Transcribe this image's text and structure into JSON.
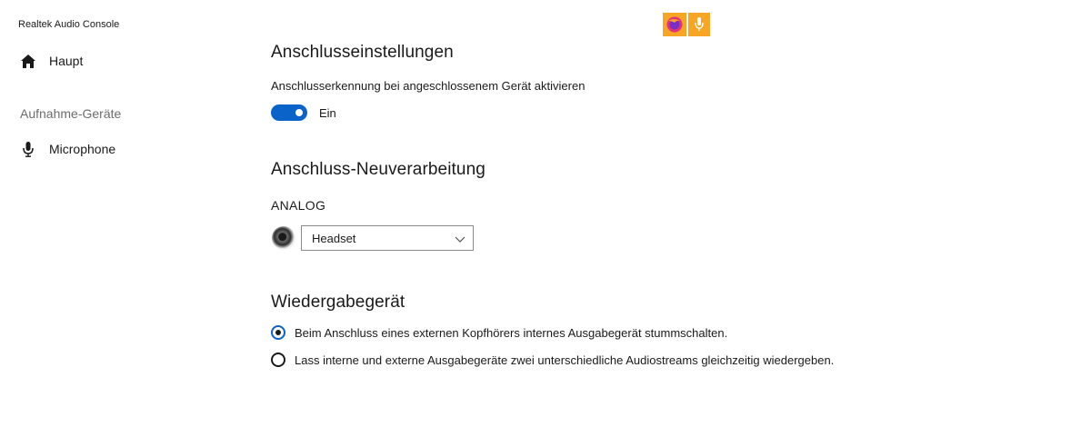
{
  "app": {
    "title": "Realtek Audio Console"
  },
  "sidebar": {
    "items": [
      {
        "label": "Haupt",
        "icon": "home-icon"
      },
      {
        "label": "Microphone",
        "icon": "microphone-icon"
      }
    ],
    "section_label": "Aufnahme-Geräte"
  },
  "tray": {
    "icons": [
      "firefox-icon",
      "microphone-icon"
    ],
    "accent": "#f6a524"
  },
  "main": {
    "connection_settings": {
      "title": "Anschlusseinstellungen",
      "description": "Anschlusserkennung bei angeschlossenem Gerät aktivieren",
      "toggle_label": "Ein",
      "toggle_on": true,
      "toggle_color": "#0a63c9"
    },
    "reassignment": {
      "title": "Anschluss-Neuverarbeitung",
      "group_label": "ANALOG",
      "device_selected": "Headset"
    },
    "playback": {
      "title": "Wiedergabegerät",
      "options": [
        {
          "label": "Beim Anschluss eines externen Kopfhörers internes Ausgabegerät stummschalten.",
          "selected": true
        },
        {
          "label": "Lass interne und externe Ausgabegeräte zwei unterschiedliche Audiostreams gleichzeitig wiedergeben.",
          "selected": false
        }
      ]
    }
  }
}
